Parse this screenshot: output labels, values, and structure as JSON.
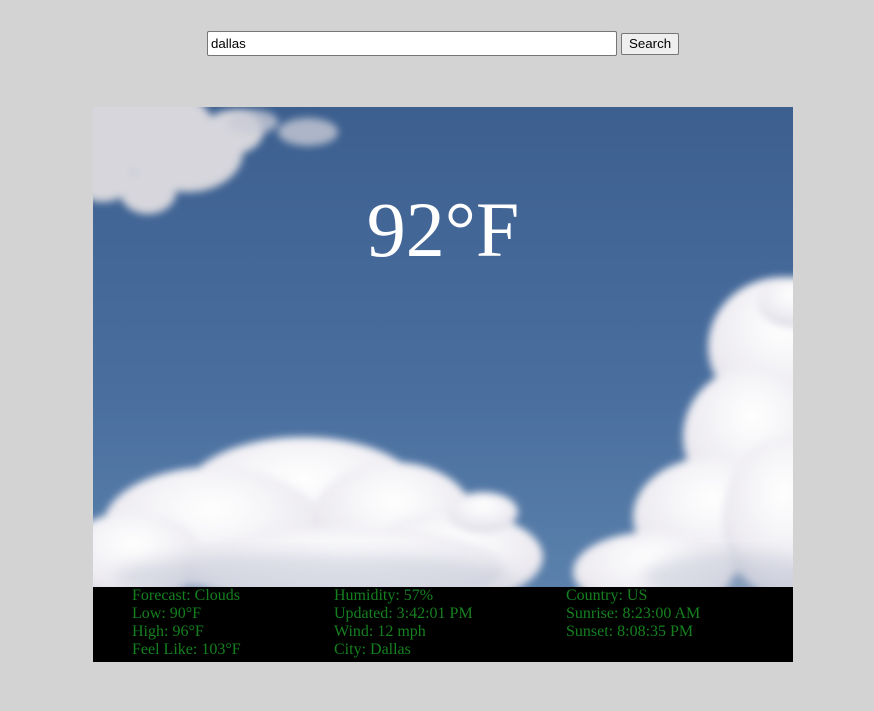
{
  "search": {
    "value": "dallas",
    "button_label": "Search"
  },
  "weather": {
    "temperature": "92°F",
    "col1": [
      "Forecast: Clouds",
      "Low: 90°F",
      "High: 96°F",
      "Feel Like: 103°F"
    ],
    "col2": [
      "Humidity: 57%",
      "Updated: 3:42:01 PM",
      "Wind: 12 mph",
      "City: Dallas"
    ],
    "col3": [
      "Country: US",
      "Sunrise: 8:23:00 AM",
      "Sunset: 8:08:35 PM"
    ]
  },
  "colors": {
    "page_background": "#d3d3d3",
    "sky_top": "#3e6291",
    "sky_bottom": "#5379a6",
    "info_panel_background": "#000000",
    "info_text": "#15801f",
    "temperature_text": "#ffffff"
  }
}
